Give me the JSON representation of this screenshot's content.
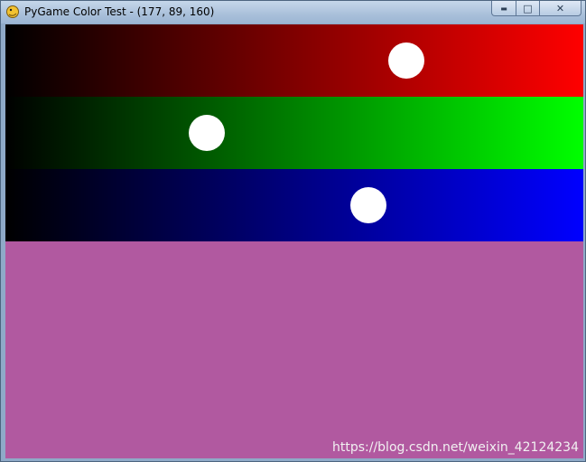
{
  "window": {
    "title": "PyGame Color Test - (177, 89, 160)",
    "icon": "pygame-snake-icon",
    "controls": [
      {
        "name": "minimize",
        "glyph": "▬"
      },
      {
        "name": "maximize",
        "glyph": "□"
      },
      {
        "name": "close",
        "glyph": "✕"
      }
    ]
  },
  "color": {
    "r": 177,
    "g": 89,
    "b": 160,
    "hex": "#b159a0"
  },
  "sliders": [
    {
      "channel": "red",
      "value": 177,
      "max": 255,
      "gradient_end": "#ff0000"
    },
    {
      "channel": "green",
      "value": 89,
      "max": 255,
      "gradient_end": "#00ff00"
    },
    {
      "channel": "blue",
      "value": 160,
      "max": 255,
      "gradient_end": "#0000ff"
    }
  ],
  "watermark": "https://blog.csdn.net/weixin_42124234"
}
